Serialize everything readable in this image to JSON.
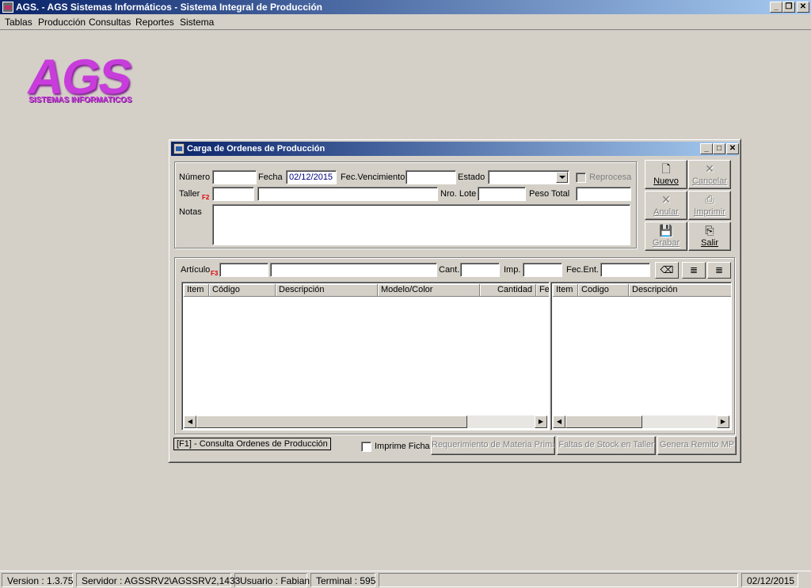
{
  "app": {
    "title": "AGS. - AGS Sistemas Informáticos - Sistema Integral de Producción"
  },
  "menu": [
    "Tablas",
    "Producción",
    "Consultas",
    "Reportes",
    "Sistema"
  ],
  "logo": {
    "mark": "AGS",
    "subtitle": "SISTEMAS INFORMATICOS",
    "color": "#c83cdc"
  },
  "dialog": {
    "title": "Carga de Ordenes de Producción",
    "header": {
      "numero_label": "Número",
      "numero_value": "",
      "fecha_label": "Fecha",
      "fecha_value": "02/12/2015",
      "vencimiento_label": "Fec.Vencimiento",
      "vencimiento_value": "",
      "estado_label": "Estado",
      "estado_value": "",
      "reprocesa_label": "Reprocesa",
      "taller_label": "Taller",
      "taller_key": "F2",
      "nro_lote_label": "Nro. Lote",
      "peso_total_label": "Peso Total",
      "notas_label": "Notas"
    },
    "buttons": {
      "nuevo": "Nuevo",
      "cancelar": "Cancelar",
      "anular": "Anular",
      "imprimir": "Imprimir",
      "grabar": "Grabar",
      "salir": "Salir"
    },
    "items": {
      "articulo_label": "Artículo",
      "articulo_key": "F3",
      "cant_label": "Cant.",
      "imp_label": "Imp.",
      "fec_ent_label": "Fec.Ent."
    },
    "grid_left_columns": [
      "Item",
      "Código",
      "Descripción",
      "Modelo/Color",
      "Cantidad",
      "Fe"
    ],
    "grid_right_columns": [
      "Item",
      "Codigo",
      "Descripción"
    ],
    "footer": {
      "hint": "[F1] - Consulta Ordenes de Producción",
      "imprime_ficha": "Imprime Ficha",
      "requerimiento": "Requerimiento de Materia Prima",
      "faltas_stock": "Faltas de Stock en Taller",
      "genera_remito": "Genera Remito MP"
    }
  },
  "status": {
    "version": "Version : 1.3.75",
    "servidor": "Servidor : AGSSRV2\\AGSSRV2,1433",
    "usuario": "Usuario : Fabian",
    "terminal": "Terminal : 595",
    "date": "02/12/2015"
  }
}
